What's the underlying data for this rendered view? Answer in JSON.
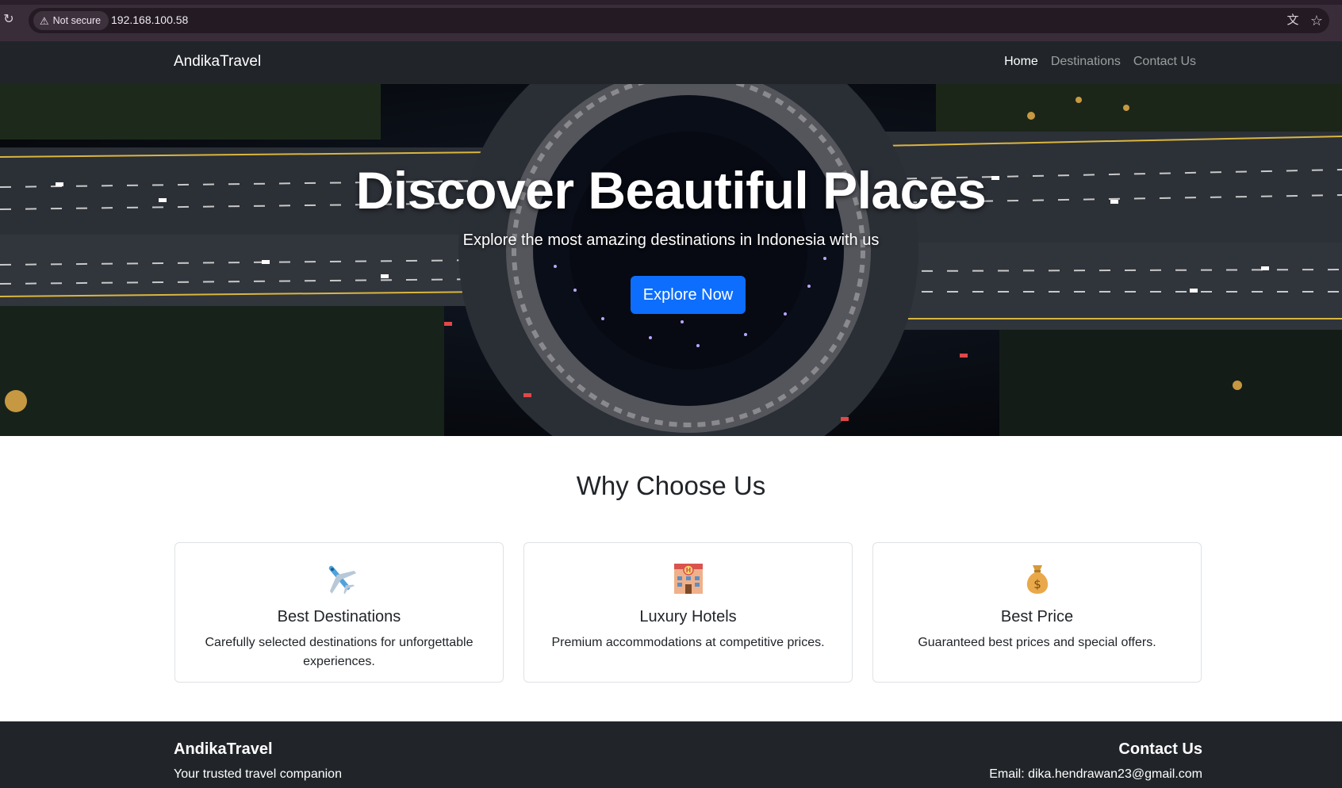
{
  "browser": {
    "security_label": "Not secure",
    "url": "192.168.100.58",
    "icons": [
      "reload-icon",
      "warning-icon",
      "translate-icon",
      "star-icon"
    ]
  },
  "navbar": {
    "brand": "AndikaTravel",
    "links": [
      {
        "label": "Home",
        "active": true
      },
      {
        "label": "Destinations",
        "active": false
      },
      {
        "label": "Contact Us",
        "active": false
      }
    ]
  },
  "hero": {
    "title": "Discover Beautiful Places",
    "subtitle": "Explore the most amazing destinations in Indonesia with us",
    "button_label": "Explore Now"
  },
  "features": {
    "title": "Why Choose Us",
    "cards": [
      {
        "icon": "airplane-icon",
        "title": "Best Destinations",
        "text": "Carefully selected destinations for unforgettable experiences."
      },
      {
        "icon": "hotel-icon",
        "title": "Luxury Hotels",
        "text": "Premium accommodations at competitive prices."
      },
      {
        "icon": "money-bag-icon",
        "title": "Best Price",
        "text": "Guaranteed best prices and special offers."
      }
    ]
  },
  "footer": {
    "brand": "AndikaTravel",
    "tagline": "Your trusted travel companion",
    "contact_title": "Contact Us",
    "email": "Email: dika.hendrawan23@gmail.com"
  },
  "colors": {
    "primary": "#0d6efd",
    "dark": "#212529",
    "browser_frame": "#3a2d3a"
  }
}
